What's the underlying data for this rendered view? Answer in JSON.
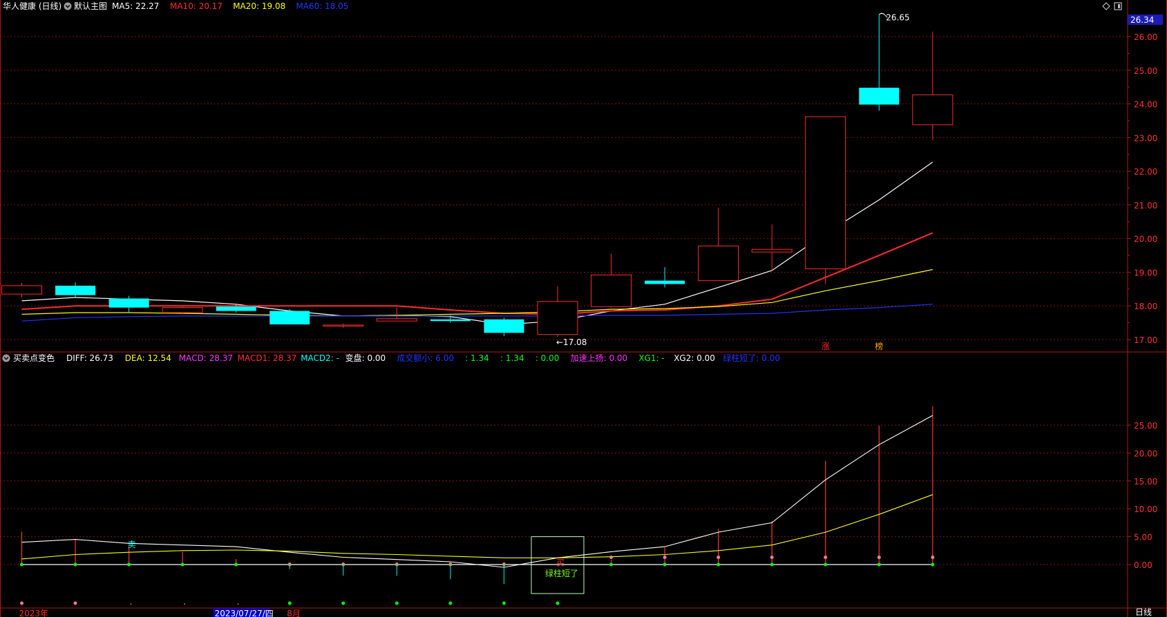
{
  "header_main": {
    "stock_title": "华人健康 (日线)",
    "preset": "默认主图",
    "ma_items": [
      {
        "label": "MA5: 22.27",
        "color": "#ffffff"
      },
      {
        "label": "MA10: 20.17",
        "color": "#ff2a2a"
      },
      {
        "label": "MA20: 19.08",
        "color": "#ffff00"
      },
      {
        "label": "MA60: 18.05",
        "color": "#2233ff"
      }
    ]
  },
  "header_sub": {
    "indicator_name": "买卖点变色",
    "items": [
      {
        "label": "DIFF: 26.73",
        "color": "#ffffff"
      },
      {
        "label": "DEA: 12.54",
        "color": "#ffff00"
      },
      {
        "label": "MACD: 28.37",
        "color": "#ff33ff"
      },
      {
        "label": "MACD1: 28.37",
        "color": "#ff2a2a"
      },
      {
        "label": "MACD2: -",
        "color": "#00ffff"
      },
      {
        "label": "变盘: 0.00",
        "color": "#ffffff"
      },
      {
        "label": "成交额小: 6.00",
        "color": "#2233ff"
      },
      {
        "label": ": 1.34",
        "color": "#00ff00"
      },
      {
        "label": ": 1.34",
        "color": "#00ff00"
      },
      {
        "label": ": 0.00",
        "color": "#00ff00"
      },
      {
        "label": "加速上扬: 0.00",
        "color": "#ff33ff"
      },
      {
        "label": "XG1: -",
        "color": "#00ff00"
      },
      {
        "label": "XG2: 0.00",
        "color": "#ffffff"
      },
      {
        "label": "绿柱短了: 0.00",
        "color": "#2233ff"
      }
    ]
  },
  "price_badge": "26.34",
  "bottom_right_label": "日线",
  "x_axis_labels": [
    {
      "index": 0,
      "text": "2023年",
      "color": "#ff2a2a"
    },
    {
      "index": 2,
      "text": "2023/07/27/四",
      "color": "#ffffff",
      "highlight": true
    },
    {
      "index": 5,
      "text": "8月",
      "color": "#ff2a2a"
    }
  ],
  "chart_data": [
    {
      "type": "candlestick",
      "name_id": "price",
      "ylim": [
        16.75,
        26.5
      ],
      "y_ticks": [
        "17.00",
        "18.00",
        "19.00",
        "20.00",
        "21.00",
        "22.00",
        "23.00",
        "24.00",
        "25.00",
        "26.00"
      ],
      "candles": [
        {
          "o": 18.35,
          "h": 18.68,
          "l": 18.25,
          "c": 18.6,
          "up": true
        },
        {
          "o": 18.6,
          "h": 18.7,
          "l": 18.25,
          "c": 18.32,
          "up": false
        },
        {
          "o": 18.22,
          "h": 18.3,
          "l": 17.8,
          "c": 17.95,
          "up": false
        },
        {
          "o": 17.8,
          "h": 17.98,
          "l": 17.75,
          "c": 17.95,
          "up": true
        },
        {
          "o": 17.98,
          "h": 18.05,
          "l": 17.8,
          "c": 17.85,
          "up": false
        },
        {
          "o": 17.85,
          "h": 17.9,
          "l": 17.45,
          "c": 17.45,
          "up": false
        },
        {
          "o": 17.4,
          "h": 17.48,
          "l": 17.35,
          "c": 17.43,
          "up": true
        },
        {
          "o": 17.55,
          "h": 17.95,
          "l": 17.55,
          "c": 17.62,
          "up": true
        },
        {
          "o": 17.6,
          "h": 17.72,
          "l": 17.5,
          "c": 17.55,
          "up": false
        },
        {
          "o": 17.6,
          "h": 17.65,
          "l": 17.1,
          "c": 17.2,
          "up": false
        },
        {
          "o": 17.15,
          "h": 18.58,
          "l": 17.08,
          "c": 18.13,
          "up": true
        },
        {
          "o": 17.98,
          "h": 19.55,
          "l": 17.95,
          "c": 18.92,
          "up": true
        },
        {
          "o": 18.75,
          "h": 19.15,
          "l": 18.55,
          "c": 18.65,
          "up": false
        },
        {
          "o": 18.75,
          "h": 20.92,
          "l": 18.75,
          "c": 19.78,
          "up": true
        },
        {
          "o": 19.6,
          "h": 20.42,
          "l": 19.05,
          "c": 19.68,
          "up": true
        },
        {
          "o": 19.1,
          "h": 23.62,
          "l": 18.65,
          "c": 23.62,
          "up": true
        },
        {
          "o": 24.48,
          "h": 26.65,
          "l": 23.8,
          "c": 23.98,
          "up": false
        },
        {
          "o": 23.38,
          "h": 26.15,
          "l": 22.92,
          "c": 24.27,
          "up": true
        }
      ],
      "series": [
        {
          "name": "MA5",
          "color": "#ffffff",
          "values": [
            18.15,
            18.25,
            18.2,
            18.15,
            18.05,
            17.85,
            17.7,
            17.72,
            17.68,
            17.45,
            17.55,
            17.85,
            18.05,
            18.55,
            19.05,
            20.15,
            21.15,
            22.27
          ]
        },
        {
          "name": "MA10",
          "color": "#ff2a2a",
          "values": [
            17.9,
            18.0,
            18.0,
            18.0,
            18.0,
            18.0,
            18.0,
            18.0,
            17.88,
            17.78,
            17.75,
            17.85,
            17.88,
            18.0,
            18.2,
            18.85,
            19.5,
            20.17
          ]
        },
        {
          "name": "MA20",
          "color": "#ffff00",
          "values": [
            17.75,
            17.8,
            17.8,
            17.78,
            17.75,
            17.72,
            17.7,
            17.72,
            17.75,
            17.78,
            17.82,
            17.9,
            17.92,
            17.98,
            18.1,
            18.45,
            18.75,
            19.08
          ]
        },
        {
          "name": "MA60",
          "color": "#2233ff",
          "values": [
            17.55,
            17.65,
            17.68,
            17.7,
            17.7,
            17.7,
            17.7,
            17.7,
            17.7,
            17.7,
            17.7,
            17.72,
            17.72,
            17.75,
            17.78,
            17.88,
            17.95,
            18.05
          ]
        }
      ],
      "annotations": [
        {
          "index": 16,
          "value": 26.65,
          "text": "26.65",
          "direction": "right"
        },
        {
          "index": 10,
          "value": 17.08,
          "text": "←17.08",
          "direction": "right"
        }
      ],
      "signal_labels": [
        {
          "index": 15,
          "text": "涨",
          "color": "#ff2a2a"
        },
        {
          "index": 16,
          "text": "榜",
          "color": "#ffaa00"
        }
      ]
    },
    {
      "type": "line",
      "name_id": "macd",
      "ylim": [
        -6,
        29
      ],
      "y_ticks": [
        "0.00",
        "5.00",
        "10.00",
        "15.00",
        "20.00",
        "25.00"
      ],
      "series": [
        {
          "name": "DIFF",
          "color": "#ffffff",
          "values": [
            4.0,
            4.5,
            3.8,
            3.5,
            3.2,
            2.2,
            1.3,
            0.9,
            0.5,
            -0.5,
            1.2,
            2.3,
            3.2,
            5.8,
            7.5,
            15.2,
            21.5,
            26.73
          ]
        },
        {
          "name": "DEA",
          "color": "#ffff00",
          "values": [
            1.0,
            1.8,
            2.2,
            2.5,
            2.6,
            2.4,
            2.0,
            1.8,
            1.5,
            1.2,
            1.2,
            1.4,
            1.8,
            2.5,
            3.5,
            5.8,
            9.0,
            12.54
          ]
        }
      ],
      "macd_bars": [
        5.9,
        4.6,
        3.3,
        2.3,
        1.0,
        -0.8,
        -2.0,
        -2.0,
        -2.6,
        -3.5,
        0.0,
        0.8,
        3.1,
        6.4,
        7.8,
        18.6,
        24.9,
        28.37
      ],
      "top_dots": [
        0,
        1,
        2,
        3,
        4,
        5,
        6,
        7,
        8,
        9,
        11,
        12,
        13,
        14,
        15,
        16,
        17
      ],
      "bottom_dots": [
        0,
        1,
        5,
        6,
        7,
        8,
        9,
        10
      ],
      "markers": [
        {
          "index": 2,
          "value": 3.6,
          "text": "卖",
          "color": "#00ffff"
        },
        {
          "index": 10,
          "value": 0.3,
          "text": "买",
          "color": "#ff2a2a"
        },
        {
          "index": 10,
          "value": -1.6,
          "text": "绿柱短了",
          "color": "#77ff00"
        }
      ]
    }
  ]
}
